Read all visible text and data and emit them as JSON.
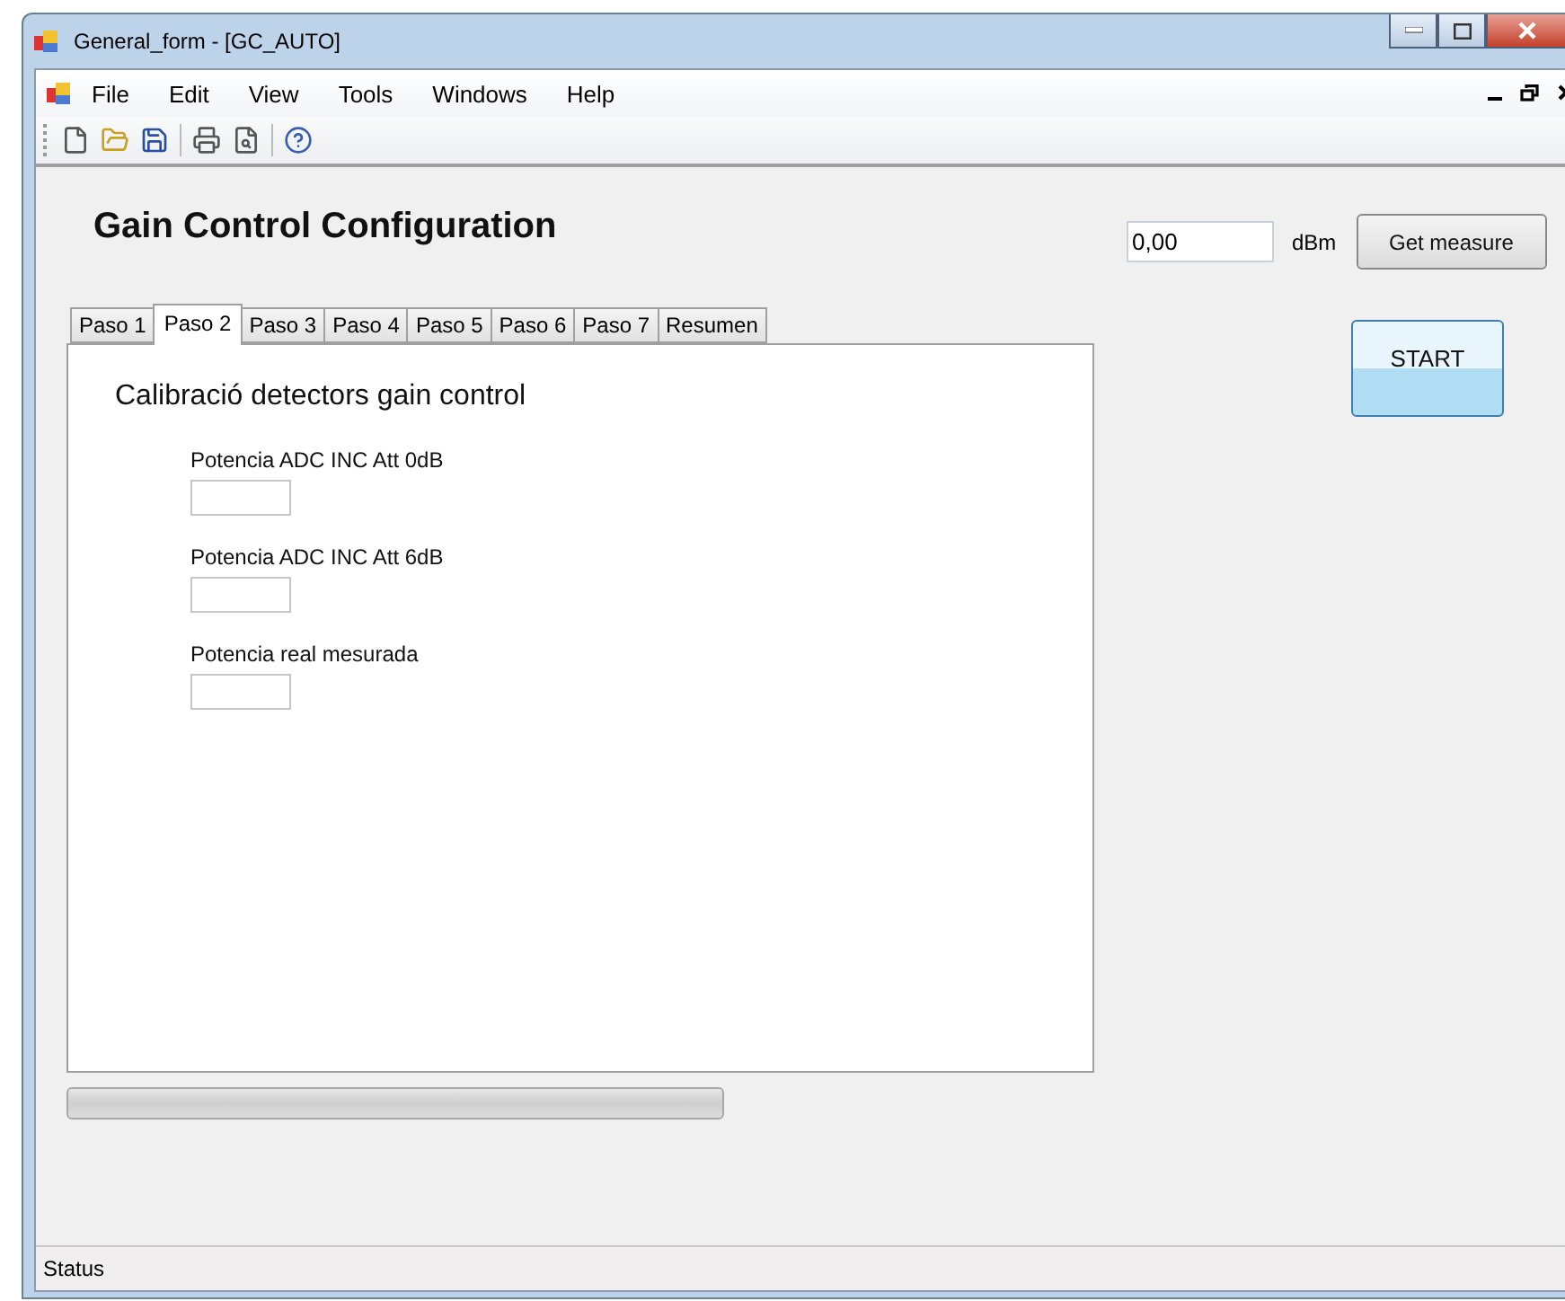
{
  "window": {
    "title": "General_form - [GC_AUTO]"
  },
  "menu": [
    "File",
    "Edit",
    "View",
    "Tools",
    "Windows",
    "Help"
  ],
  "heading": "Gain Control Configuration",
  "measure": {
    "value": "0,00",
    "unit": "dBm",
    "button": "Get measure"
  },
  "start_button": "START",
  "tabs": [
    {
      "label": "Paso 1",
      "selected": false
    },
    {
      "label": "Paso 2",
      "selected": true
    },
    {
      "label": "Paso 3",
      "selected": false
    },
    {
      "label": "Paso 4",
      "selected": false
    },
    {
      "label": "Paso 5",
      "selected": false
    },
    {
      "label": "Paso 6",
      "selected": false
    },
    {
      "label": "Paso 7",
      "selected": false
    },
    {
      "label": "Resumen",
      "selected": false
    }
  ],
  "panel": {
    "title": "Calibració detectors gain control",
    "fields": [
      {
        "label": "Potencia ADC INC Att 0dB"
      },
      {
        "label": "Potencia ADC INC Att 6dB"
      },
      {
        "label": "Potencia real mesurada"
      }
    ]
  },
  "status_bar": "Status"
}
